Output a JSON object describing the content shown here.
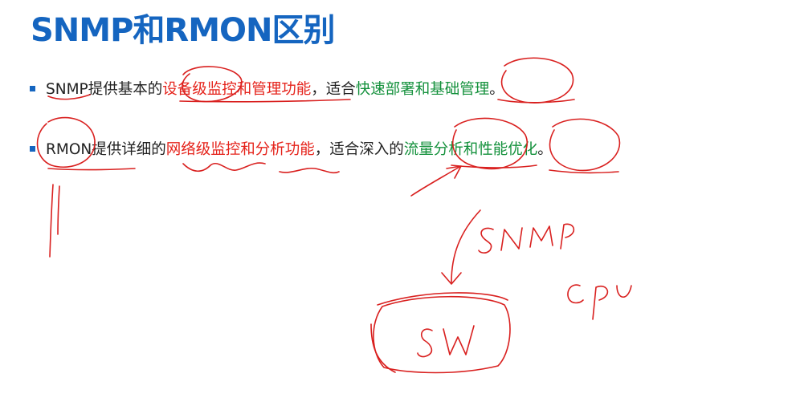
{
  "title": "SNMP和RMON区别",
  "bullets": [
    {
      "prefix": "SNMP提供基本的",
      "highlight1": "设备级监控和管理功能",
      "middle": "，适合",
      "highlight2": "快速部署和基础管理",
      "suffix": "。"
    },
    {
      "prefix": "RMON提供详细的",
      "highlight1": "网络级监控和分析功能",
      "middle": "，适合深入的",
      "highlight2": "流量分析和性能优化",
      "suffix": "。"
    }
  ],
  "colors": {
    "title": "#1565c0",
    "marker": "#1565c0",
    "highlight_red": "#e5231b",
    "highlight_green": "#14913c",
    "ink": "#d9201f"
  }
}
